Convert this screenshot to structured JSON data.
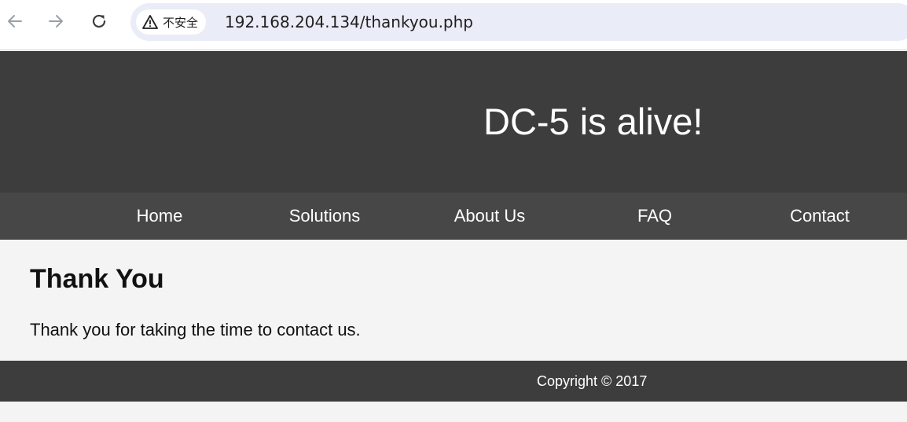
{
  "browser": {
    "security_label": "不安全",
    "url": "192.168.204.134/thankyou.php",
    "icons": {
      "back": "back-arrow-icon",
      "forward": "forward-arrow-icon",
      "reload": "reload-icon",
      "warning": "warning-triangle-icon"
    }
  },
  "site": {
    "title": "DC-5 is alive!",
    "nav": [
      {
        "label": "Home"
      },
      {
        "label": "Solutions"
      },
      {
        "label": "About Us"
      },
      {
        "label": "FAQ"
      },
      {
        "label": "Contact"
      }
    ]
  },
  "main": {
    "heading": "Thank You",
    "text": "Thank you for taking the time to contact us."
  },
  "footer": {
    "copyright": "Copyright © 2017"
  },
  "colors": {
    "header_bg": "#3d3d3d",
    "nav_bg": "#474747",
    "content_bg": "#f4f4f4",
    "address_bar_bg": "#eaedf7"
  }
}
